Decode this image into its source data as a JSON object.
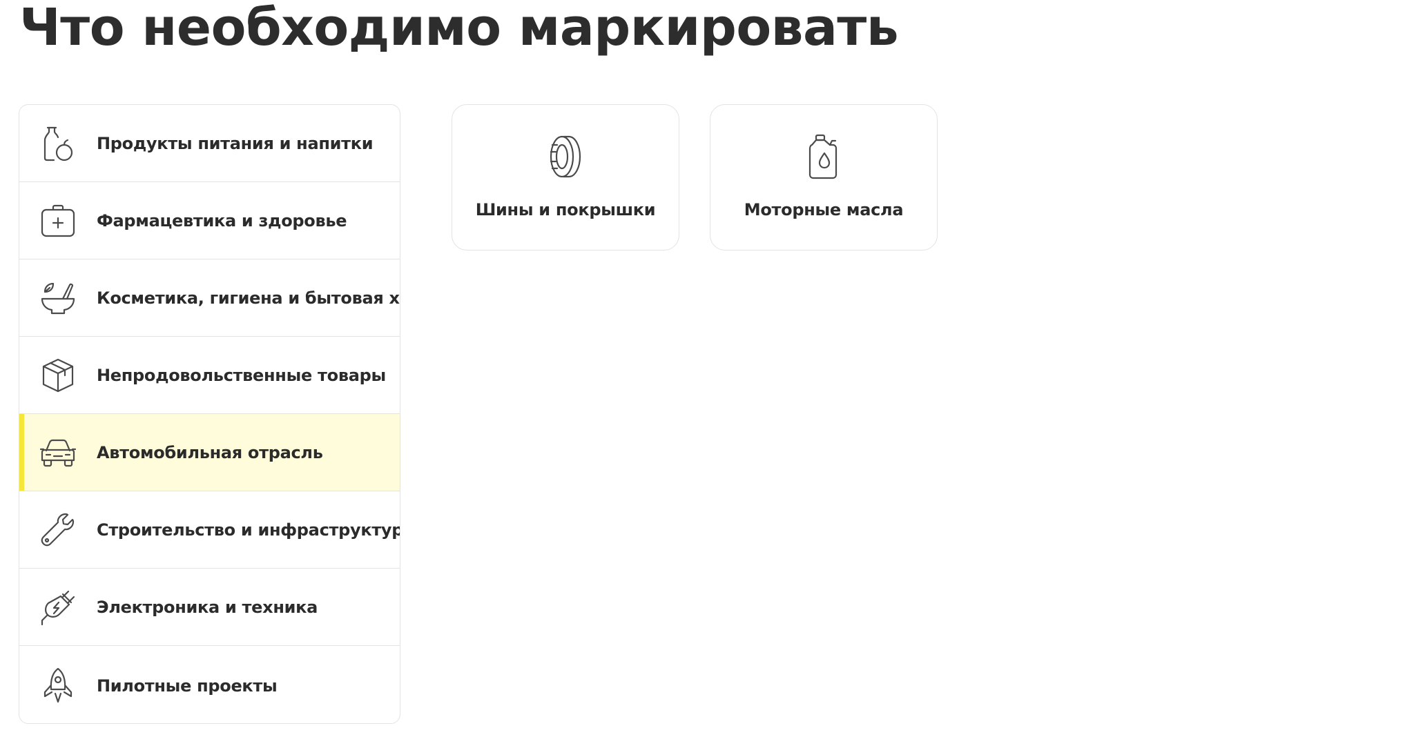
{
  "page": {
    "title": "Что необходимо маркировать"
  },
  "categories": [
    {
      "label": "Продукты питания и напитки",
      "icon": "food-bottle-apple-icon",
      "active": false
    },
    {
      "label": "Фармацевтика и здоровье",
      "icon": "first-aid-kit-icon",
      "active": false
    },
    {
      "label": "Косметика, гигиена и бытовая химия",
      "icon": "mortar-pestle-icon",
      "active": false
    },
    {
      "label": "Непродовольственные товары",
      "icon": "box-icon",
      "active": false
    },
    {
      "label": "Автомобильная отрасль",
      "icon": "car-icon",
      "active": true
    },
    {
      "label": "Строительство и инфраструктура",
      "icon": "wrench-icon",
      "active": false
    },
    {
      "label": "Электроника и техника",
      "icon": "plug-icon",
      "active": false
    },
    {
      "label": "Пилотные проекты",
      "icon": "rocket-icon",
      "active": false
    }
  ],
  "subcategories": [
    {
      "label": "Шины и покрышки",
      "icon": "tire-icon"
    },
    {
      "label": "Моторные масла",
      "icon": "oil-canister-icon"
    }
  ],
  "colors": {
    "active_background": "#fffcdb",
    "active_accent": "#f5e63a",
    "border": "#e3e3e3",
    "text": "#2b2b2b",
    "icon_stroke": "#4a4a4a"
  }
}
